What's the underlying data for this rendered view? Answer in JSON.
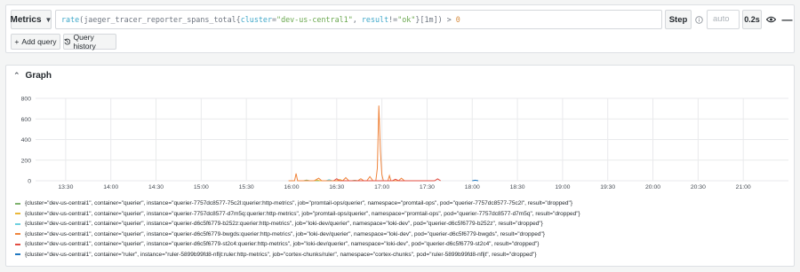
{
  "query_editor": {
    "metrics_label": "Metrics",
    "query_tokens": [
      {
        "t": "rate",
        "c": "tok-fn"
      },
      {
        "t": "(",
        "c": "tok-op"
      },
      {
        "t": "jaeger_tracer_reporter_spans_total",
        "c": "tok-metric"
      },
      {
        "t": "{",
        "c": "tok-brace"
      },
      {
        "t": "cluster",
        "c": "tok-label"
      },
      {
        "t": "=",
        "c": "tok-op"
      },
      {
        "t": "\"dev-us-central1\"",
        "c": "tok-str"
      },
      {
        "t": ", ",
        "c": "tok-op"
      },
      {
        "t": "result",
        "c": "tok-label"
      },
      {
        "t": "!=",
        "c": "tok-op"
      },
      {
        "t": "\"ok\"",
        "c": "tok-str"
      },
      {
        "t": "}",
        "c": "tok-brace"
      },
      {
        "t": "[1m]",
        "c": "tok-op"
      },
      {
        "t": ")",
        "c": "tok-op"
      },
      {
        "t": " > ",
        "c": "tok-op"
      },
      {
        "t": "0",
        "c": "tok-num"
      }
    ],
    "step_label": "Step",
    "step_placeholder": "auto",
    "duration_label": "0.2s",
    "add_query_label": "Add query",
    "query_history_label": "Query history"
  },
  "graph": {
    "title": "Graph"
  },
  "chart_data": {
    "type": "line",
    "y_ticks": [
      "0",
      "200",
      "400",
      "600",
      "800"
    ],
    "ylim": [
      0,
      800
    ],
    "x_ticks": [
      "13:30",
      "14:00",
      "14:30",
      "15:00",
      "15:30",
      "16:00",
      "16:30",
      "17:00",
      "17:30",
      "18:00",
      "18:30",
      "19:00",
      "19:30",
      "20:00",
      "20:30",
      "21:00"
    ],
    "xlim_minutes": [
      790,
      1290
    ],
    "grid": true,
    "series": [
      {
        "name": "{cluster=\"dev-us-central1\", container=\"querier\", instance=\"querier-7757dc8577-75c2l:querier:http-metrics\", job=\"promtail-ops/querier\", namespace=\"promtail-ops\", pod=\"querier-7757dc8577-75c2l\", result=\"dropped\"}",
        "color": "#7eb26d",
        "points": [
          [
            968,
            0
          ],
          [
            970,
            6
          ],
          [
            972,
            0
          ],
          [
            1000,
            0
          ],
          [
            1002,
            4
          ],
          [
            1004,
            0
          ]
        ]
      },
      {
        "name": "{cluster=\"dev-us-central1\", container=\"querier\", instance=\"querier-7757dc8577-d7m5q:querier:http-metrics\", job=\"promtail-ops/querier\", namespace=\"promtail-ops\", pod=\"querier-7757dc8577-d7m5q\", result=\"dropped\"}",
        "color": "#eab839",
        "points": [
          [
            975,
            0
          ],
          [
            977,
            8
          ],
          [
            979,
            0
          ],
          [
            990,
            0
          ],
          [
            992,
            12
          ],
          [
            994,
            0
          ]
        ]
      },
      {
        "name": "{cluster=\"dev-us-central1\", container=\"querier\", instance=\"querier-d6c5f6779-b252z:querier:http-metrics\", job=\"loki-dev/querier\", namespace=\"loki-dev\", pod=\"querier-d6c5f6779-b252z\", result=\"dropped\"}",
        "color": "#6ed0e0",
        "points": [
          [
            983,
            0
          ],
          [
            985,
            10
          ],
          [
            987,
            0
          ]
        ]
      },
      {
        "name": "{cluster=\"dev-us-central1\", container=\"querier\", instance=\"querier-d6c5f6779-bwgds:querier:http-metrics\", job=\"loki-dev/querier\", namespace=\"loki-dev\", pod=\"querier-d6c5f6779-bwgds\", result=\"dropped\"}",
        "color": "#ef843c",
        "points": [
          [
            958,
            0
          ],
          [
            962,
            0
          ],
          [
            963,
            70
          ],
          [
            964,
            0
          ],
          [
            975,
            0
          ],
          [
            978,
            25
          ],
          [
            980,
            0
          ],
          [
            994,
            0
          ],
          [
            996,
            30
          ],
          [
            998,
            0
          ],
          [
            1004,
            0
          ],
          [
            1006,
            20
          ],
          [
            1008,
            0
          ],
          [
            1010,
            0
          ],
          [
            1012,
            40
          ],
          [
            1014,
            0
          ],
          [
            1016,
            0
          ],
          [
            1017,
            120
          ],
          [
            1018,
            730
          ],
          [
            1019,
            300
          ],
          [
            1020,
            60
          ],
          [
            1021,
            0
          ],
          [
            1024,
            0
          ],
          [
            1025,
            50
          ],
          [
            1026,
            0
          ],
          [
            1031,
            0
          ],
          [
            1033,
            25
          ],
          [
            1035,
            0
          ]
        ]
      },
      {
        "name": "{cluster=\"dev-us-central1\", container=\"querier\", instance=\"querier-d6c5f6779-st2c4:querier:http-metrics\", job=\"loki-dev/querier\", namespace=\"loki-dev\", pod=\"querier-d6c5f6779-st2c4\", result=\"dropped\"}",
        "color": "#e24d42",
        "points": [
          [
            988,
            0
          ],
          [
            990,
            20
          ],
          [
            992,
            0
          ],
          [
            1027,
            0
          ],
          [
            1029,
            15
          ],
          [
            1031,
            0
          ],
          [
            1055,
            0
          ],
          [
            1057,
            18
          ],
          [
            1059,
            0
          ]
        ]
      },
      {
        "name": "{cluster=\"dev-us-central1\", container=\"ruler\", instance=\"ruler-5899b99fd8-nfljt:ruler:http-metrics\", job=\"cortex-chunks/ruler\", namespace=\"cortex-chunks\", pod=\"ruler-5899b99fd8-nfljt\", result=\"dropped\"}",
        "color": "#1f78c1",
        "points": [
          [
            1080,
            0
          ],
          [
            1082,
            5
          ],
          [
            1084,
            0
          ]
        ]
      }
    ]
  }
}
